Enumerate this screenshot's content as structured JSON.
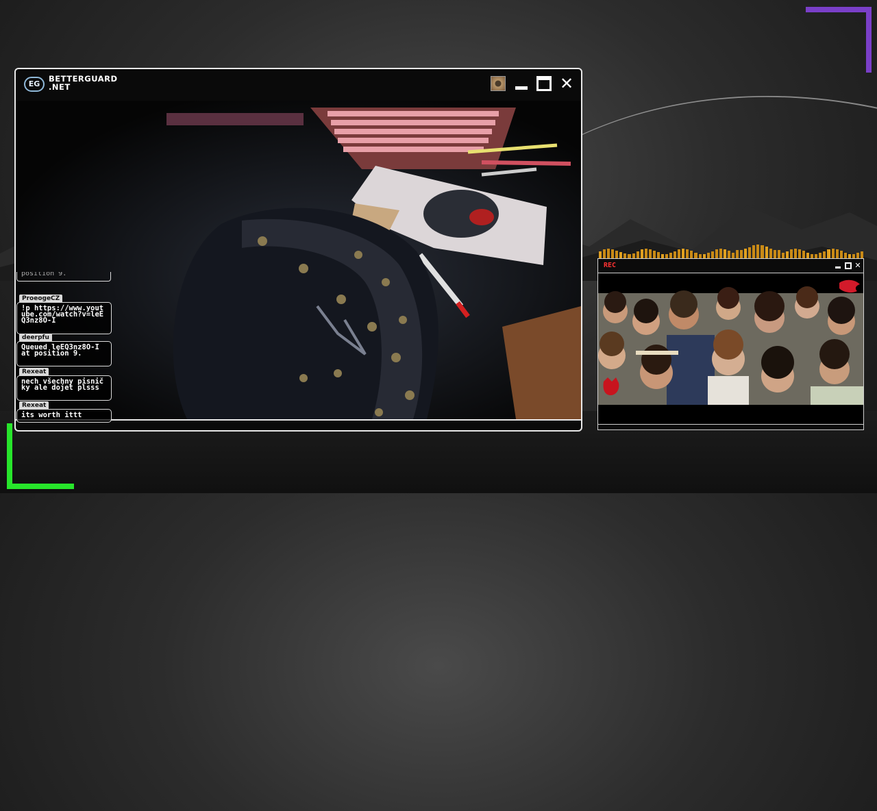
{
  "app": {
    "logo_text": "EG",
    "brand_line1": "BETTERGUARD",
    "brand_line2": ".NET"
  },
  "window_controls": {
    "minimize": "minimize",
    "maximize": "maximize",
    "close": "✕"
  },
  "chat": {
    "partial_text": "position 9.",
    "messages": [
      {
        "user": "ProeogeCZ",
        "text": "!p https://www.youtube.com/watch?v=leEQ3nz8O-I"
      },
      {
        "user": "deerpfu",
        "text": "Queued leEQ3nz8O-I at position 9."
      },
      {
        "user": "Rexeat",
        "text": "nech všechny pisničky ale dojet plsss"
      },
      {
        "user": "Rexeat",
        "text": "its worth ittt"
      }
    ]
  },
  "side_window": {
    "rec_label": "REC",
    "close_symbol": "✕"
  },
  "colors": {
    "accent_purple": "#7a3fc8",
    "accent_green": "#27e52b",
    "rec_red": "#ff3232",
    "viz_orange": "#c98a16"
  },
  "icons": {
    "logo": "eg-logo-icon",
    "camera_thumbnail": "eye-thumbnail-icon",
    "mascot": "red-dragon-icon"
  }
}
